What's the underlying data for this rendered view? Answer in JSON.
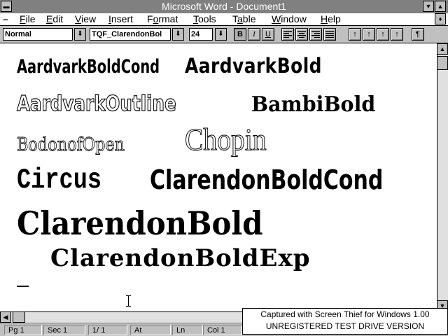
{
  "window": {
    "title": "Microsoft Word - Document1",
    "system_menu_icon": "system-menu-dash-icon",
    "minimize_icon": "down-triangle-icon",
    "maximize_icon": "up-triangle-icon"
  },
  "menu": {
    "doc_control": "–",
    "items": [
      {
        "pre": "",
        "key": "F",
        "post": "ile"
      },
      {
        "pre": "",
        "key": "E",
        "post": "dit"
      },
      {
        "pre": "",
        "key": "V",
        "post": "iew"
      },
      {
        "pre": "",
        "key": "I",
        "post": "nsert"
      },
      {
        "pre": "F",
        "key": "o",
        "post": "rmat"
      },
      {
        "pre": "",
        "key": "T",
        "post": "ools"
      },
      {
        "pre": "T",
        "key": "a",
        "post": "ble"
      },
      {
        "pre": "",
        "key": "W",
        "post": "indow"
      },
      {
        "pre": "",
        "key": "H",
        "post": "elp"
      }
    ]
  },
  "toolbar": {
    "style_value": "Normal",
    "font_value": "TQF_ClarendonBol",
    "size_value": "24",
    "dropdown_glyph": "⬇",
    "bold": "B",
    "italic": "I",
    "underline": "U",
    "indent_glyph": "↑",
    "para_glyph": "¶"
  },
  "document": {
    "samples": [
      "AardvarkBoldCond",
      "AardvarkBold",
      "AardvarkOutline",
      "BambiBold",
      "BodonofOpen",
      "Chopin",
      "Circus",
      "ClarendonBoldCond",
      "ClarendonBold",
      "ClarendonBoldExp"
    ]
  },
  "scroll": {
    "up": "▲",
    "down": "▼",
    "left": "◀",
    "right": "▶"
  },
  "status": {
    "page": "Pg 1",
    "section": "Sec 1",
    "page_of": "1/ 1",
    "at": "At",
    "line": "Ln",
    "col": "Col 1"
  },
  "watermark": {
    "line1": "Captured with Screen Thief for Windows 1.00",
    "line2": "UNREGISTERED TEST DRIVE VERSION"
  }
}
